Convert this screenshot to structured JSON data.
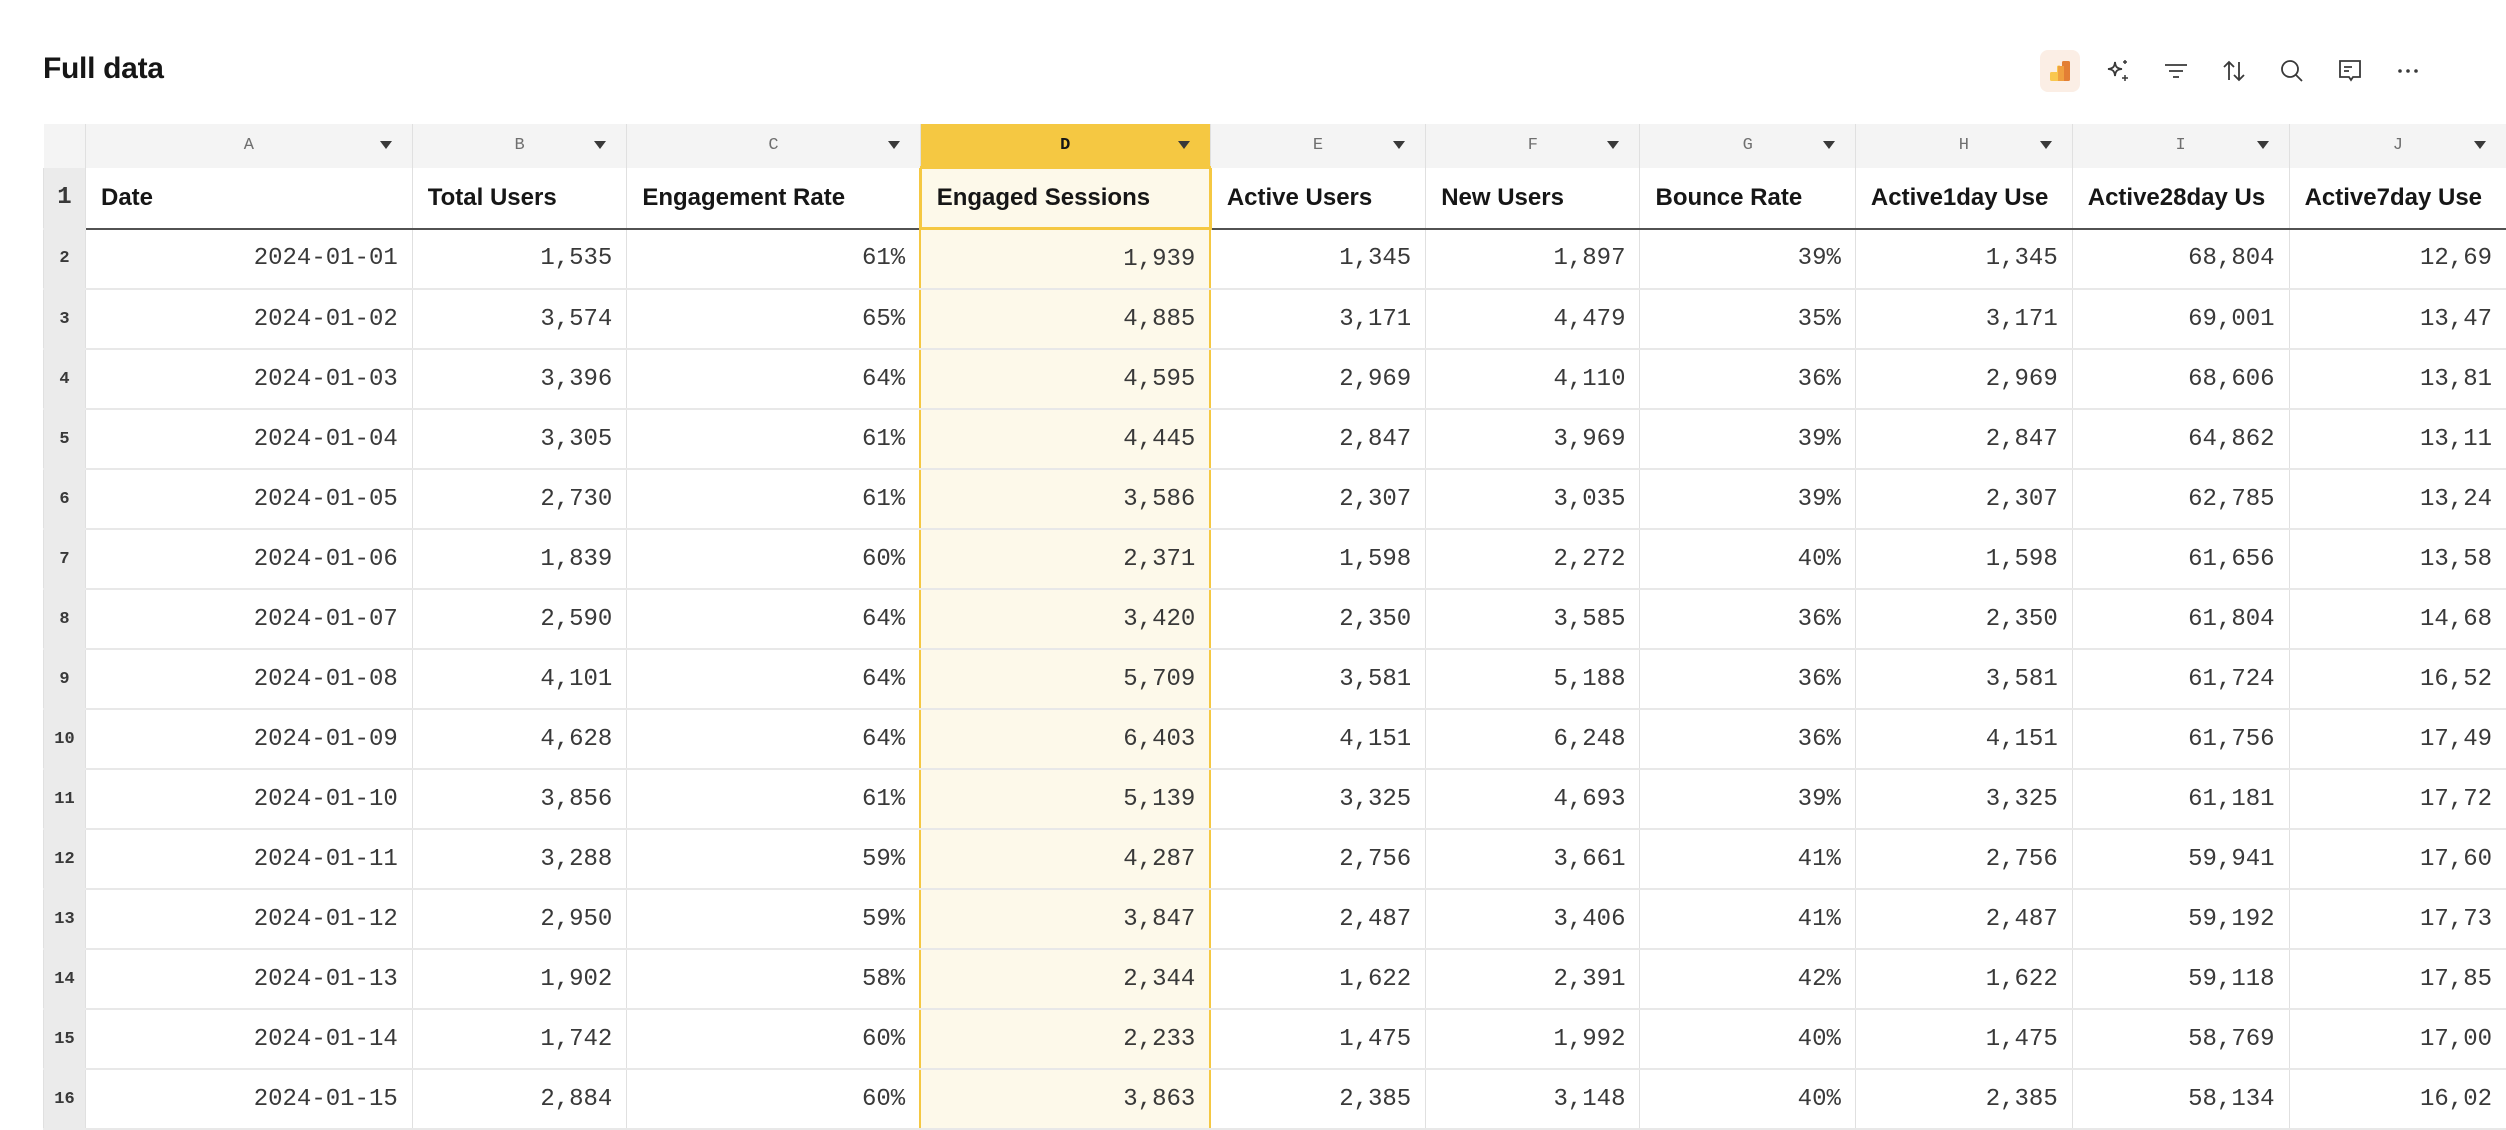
{
  "page": {
    "title": "Full data"
  },
  "toolbar": {
    "icons": [
      "analytics-brand-icon",
      "ai-sparkle-icon",
      "filter-icon",
      "sort-icon",
      "search-icon",
      "comment-icon",
      "more-icon"
    ],
    "brand_colors": {
      "light": "#f9c74f",
      "dark": "#e37f35"
    }
  },
  "selected_column": "D",
  "accent_color": "#f5c842",
  "columns": [
    {
      "letter": "A",
      "header": "Date"
    },
    {
      "letter": "B",
      "header": "Total Users"
    },
    {
      "letter": "C",
      "header": "Engagement Rate"
    },
    {
      "letter": "D",
      "header": "Engaged Sessions"
    },
    {
      "letter": "E",
      "header": "Active Users"
    },
    {
      "letter": "F",
      "header": "New Users"
    },
    {
      "letter": "G",
      "header": "Bounce Rate"
    },
    {
      "letter": "H",
      "header": "Active1day Use"
    },
    {
      "letter": "I",
      "header": "Active28day Us"
    },
    {
      "letter": "J",
      "header": "Active7day Use"
    }
  ],
  "header_row_number": "1",
  "rows": [
    {
      "n": "2",
      "cells": [
        "2024-01-01",
        "1,535",
        "61%",
        "1,939",
        "1,345",
        "1,897",
        "39%",
        "1,345",
        "68,804",
        "12,69"
      ]
    },
    {
      "n": "3",
      "cells": [
        "2024-01-02",
        "3,574",
        "65%",
        "4,885",
        "3,171",
        "4,479",
        "35%",
        "3,171",
        "69,001",
        "13,47"
      ]
    },
    {
      "n": "4",
      "cells": [
        "2024-01-03",
        "3,396",
        "64%",
        "4,595",
        "2,969",
        "4,110",
        "36%",
        "2,969",
        "68,606",
        "13,81"
      ]
    },
    {
      "n": "5",
      "cells": [
        "2024-01-04",
        "3,305",
        "61%",
        "4,445",
        "2,847",
        "3,969",
        "39%",
        "2,847",
        "64,862",
        "13,11"
      ]
    },
    {
      "n": "6",
      "cells": [
        "2024-01-05",
        "2,730",
        "61%",
        "3,586",
        "2,307",
        "3,035",
        "39%",
        "2,307",
        "62,785",
        "13,24"
      ]
    },
    {
      "n": "7",
      "cells": [
        "2024-01-06",
        "1,839",
        "60%",
        "2,371",
        "1,598",
        "2,272",
        "40%",
        "1,598",
        "61,656",
        "13,58"
      ]
    },
    {
      "n": "8",
      "cells": [
        "2024-01-07",
        "2,590",
        "64%",
        "3,420",
        "2,350",
        "3,585",
        "36%",
        "2,350",
        "61,804",
        "14,68"
      ]
    },
    {
      "n": "9",
      "cells": [
        "2024-01-08",
        "4,101",
        "64%",
        "5,709",
        "3,581",
        "5,188",
        "36%",
        "3,581",
        "61,724",
        "16,52"
      ]
    },
    {
      "n": "10",
      "cells": [
        "2024-01-09",
        "4,628",
        "64%",
        "6,403",
        "4,151",
        "6,248",
        "36%",
        "4,151",
        "61,756",
        "17,49"
      ]
    },
    {
      "n": "11",
      "cells": [
        "2024-01-10",
        "3,856",
        "61%",
        "5,139",
        "3,325",
        "4,693",
        "39%",
        "3,325",
        "61,181",
        "17,72"
      ]
    },
    {
      "n": "12",
      "cells": [
        "2024-01-11",
        "3,288",
        "59%",
        "4,287",
        "2,756",
        "3,661",
        "41%",
        "2,756",
        "59,941",
        "17,60"
      ]
    },
    {
      "n": "13",
      "cells": [
        "2024-01-12",
        "2,950",
        "59%",
        "3,847",
        "2,487",
        "3,406",
        "41%",
        "2,487",
        "59,192",
        "17,73"
      ]
    },
    {
      "n": "14",
      "cells": [
        "2024-01-13",
        "1,902",
        "58%",
        "2,344",
        "1,622",
        "2,391",
        "42%",
        "1,622",
        "59,118",
        "17,85"
      ]
    },
    {
      "n": "15",
      "cells": [
        "2024-01-14",
        "1,742",
        "60%",
        "2,233",
        "1,475",
        "1,992",
        "40%",
        "1,475",
        "58,769",
        "17,00"
      ]
    },
    {
      "n": "16",
      "cells": [
        "2024-01-15",
        "2,884",
        "60%",
        "3,863",
        "2,385",
        "3,148",
        "40%",
        "2,385",
        "58,134",
        "16,02"
      ]
    }
  ]
}
